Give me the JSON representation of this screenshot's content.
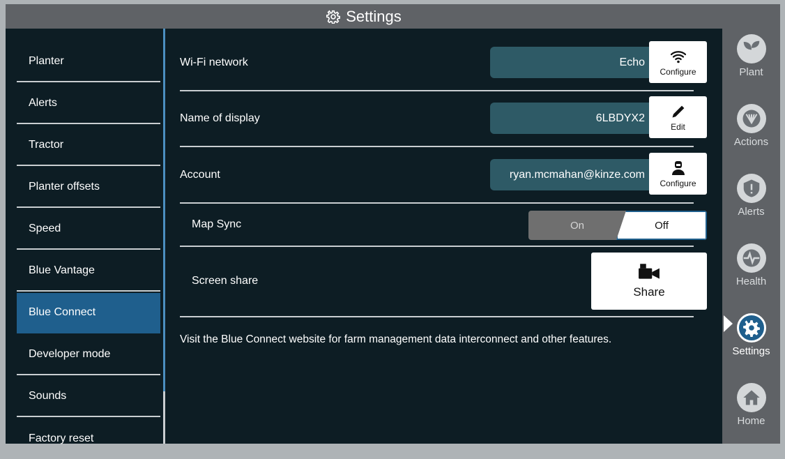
{
  "title": "Settings",
  "sidebar": {
    "items": [
      {
        "label": "Planter"
      },
      {
        "label": "Alerts"
      },
      {
        "label": "Tractor"
      },
      {
        "label": "Planter offsets"
      },
      {
        "label": "Speed"
      },
      {
        "label": "Blue Vantage"
      },
      {
        "label": "Blue Connect",
        "active": true
      },
      {
        "label": "Developer mode"
      },
      {
        "label": "Sounds"
      },
      {
        "label": "Factory reset"
      }
    ]
  },
  "content": {
    "wifi": {
      "label": "Wi-Fi network",
      "value": "Echo",
      "button": "Configure",
      "icon": "wifi-icon"
    },
    "display_name": {
      "label": "Name of display",
      "value": "6LBDYX2",
      "button": "Edit",
      "icon": "pencil-icon"
    },
    "account": {
      "label": "Account",
      "value": "ryan.mcmahan@kinze.com",
      "button": "Configure",
      "icon": "user-icon"
    },
    "map_sync": {
      "label": "Map Sync",
      "on_label": "On",
      "off_label": "Off",
      "selected": "Off"
    },
    "screen_share": {
      "label": "Screen share",
      "button": "Share",
      "icon": "video-camera-icon"
    },
    "info_text": "Visit the Blue Connect website for farm management data interconnect and other features."
  },
  "rail": {
    "items": [
      {
        "label": "Plant",
        "icon": "plant-icon"
      },
      {
        "label": "Actions",
        "icon": "actions-icon"
      },
      {
        "label": "Alerts",
        "icon": "alert-shield-icon"
      },
      {
        "label": "Health",
        "icon": "heartbeat-icon"
      },
      {
        "label": "Settings",
        "icon": "gear-icon",
        "active": true
      },
      {
        "label": "Home",
        "icon": "home-icon"
      }
    ]
  },
  "colors": {
    "accent": "#1f5f8d",
    "background": "#0d1d24",
    "rail": "#5f6266",
    "field": "#2e5a66"
  }
}
